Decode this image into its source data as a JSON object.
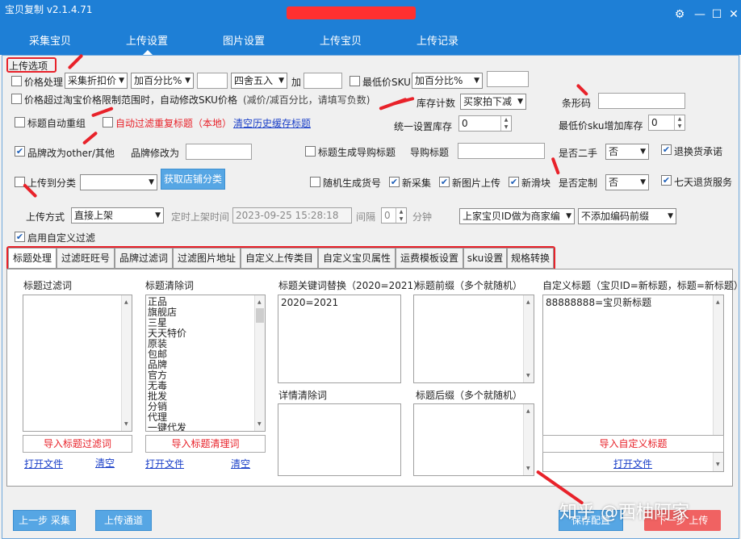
{
  "window": {
    "title": "宝贝复制 v2.1.4.71"
  },
  "nav": {
    "tabs": [
      "采集宝贝",
      "上传设置",
      "图片设置",
      "上传宝贝",
      "上传记录"
    ],
    "active": "上传设置"
  },
  "upload": {
    "section": "上传选项",
    "price_process": "价格处理",
    "price_mode": "采集折扣价",
    "price_pct": "加百分比%",
    "rounding": "四舍五入",
    "add": "加",
    "min_sku": "最低价SKU",
    "min_sku_pct": "加百分比%",
    "price_exceed": "价格超过淘宝价格限制范围时，自动修改SKU价格",
    "price_exceed_hint": "(减价/减百分比，请填写负数)",
    "stock_count": "库存计数",
    "stock_mode": "买家拍下减",
    "barcode": "条形码",
    "title_regroup": "标题自动重组",
    "auto_filter_dup": "自动过滤重复标题（本地）",
    "clear_cache": "清空历史缓存标题",
    "unified_stock": "统一设置库存",
    "unified_stock_val": "0",
    "min_sku_stock": "最低价sku增加库存",
    "min_sku_stock_val": "0",
    "brand_other": "品牌改为other/其他",
    "brand_change": "品牌修改为",
    "title_guide": "标题生成导购标题",
    "guide_title": "导购标题",
    "second_hand": "是否二手",
    "second_hand_val": "否",
    "return_promise": "退换货承诺",
    "upload_category": "上传到分类",
    "get_shop_cat": "获取店铺分类",
    "random_code": "随机生成货号",
    "new_collect": "新采集",
    "new_image": "新图片上传",
    "new_slider": "新滑块",
    "customized": "是否定制",
    "customized_val": "否",
    "seven_day": "七天退货服务",
    "upload_mode": "上传方式",
    "upload_mode_val": "直接上架",
    "timed": "定时上架时间",
    "timed_val": "2023-09-25 15:28:18",
    "interval": "间隔",
    "interval_val": "0",
    "minute": "分钟",
    "merchant_code": "上家宝贝ID做为商家编",
    "prefix": "不添加编码前缀",
    "enable_filter": "启用自定义过滤"
  },
  "subtabs": [
    "标题处理",
    "过滤旺旺号",
    "品牌过滤词",
    "过滤图片地址",
    "自定义上传类目",
    "自定义宝贝属性",
    "运费模板设置",
    "sku设置",
    "规格转换"
  ],
  "title_panel": {
    "filter_words": "标题过滤词",
    "clear_words": "标题清除词",
    "clear_list": [
      "正品",
      "旗舰店",
      "三星",
      "天天特价",
      "原装",
      "包邮",
      "品牌",
      "官方",
      "无毒",
      "批发",
      "分销",
      "代理",
      "一键代发"
    ],
    "keyword_replace": "标题关键词替换（2020=2021）",
    "keyword_replace_val": "2020=2021",
    "prefix": "标题前缀（多个就随机）",
    "custom": "自定义标题（宝贝ID=新标题，标题=新标题）",
    "custom_val": "88888888=宝贝新标题",
    "detail_clear": "详情清除词",
    "suffix": "标题后缀（多个就随机）",
    "import_filter": "导入标题过滤词",
    "import_clear": "导入标题清理词",
    "import_custom": "导入自定义标题",
    "open_file": "打开文件",
    "clear": "清空"
  },
  "footer": {
    "prev": "上一步 采集",
    "channel": "上传通道",
    "save": "保存配置",
    "next": "下一步 上传"
  },
  "watermark": "知乎 @西柚阿家"
}
